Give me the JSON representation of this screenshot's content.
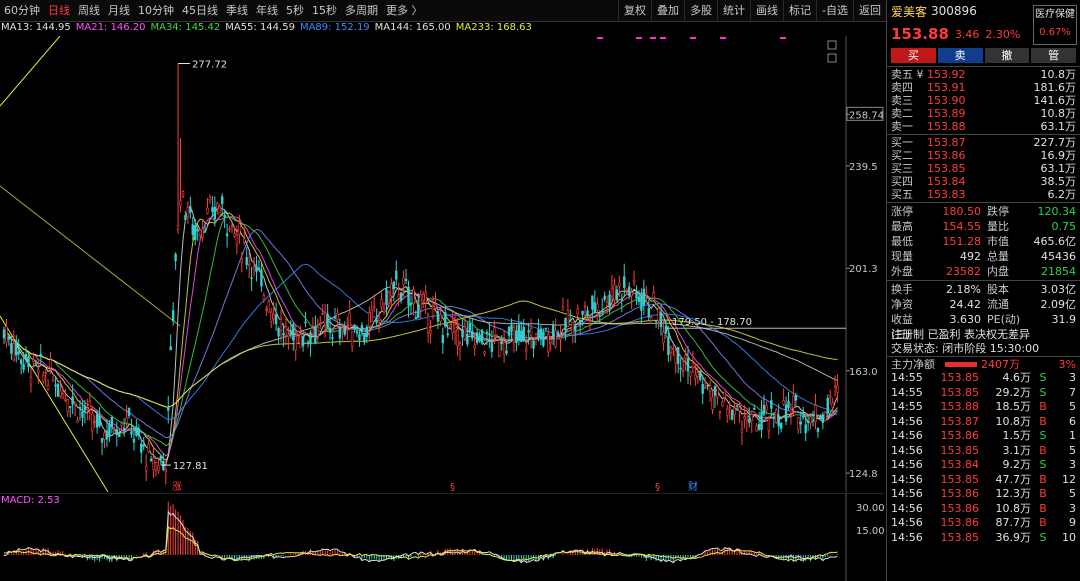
{
  "toolbar": {
    "periods": [
      "60分钟",
      "日线",
      "周线",
      "月线",
      "10分钟",
      "45日线",
      "季线",
      "年线",
      "5秒",
      "15秒",
      "多周期",
      "更多 〉"
    ],
    "active_period": "日线",
    "tools": [
      "复权",
      "叠加",
      "多股",
      "统计",
      "画线",
      "标记",
      "-自选",
      "返回"
    ]
  },
  "ma_line": [
    {
      "text": "MA13: 144.95",
      "color": "#e0e0e0"
    },
    {
      "text": "MA21: 146.20",
      "color": "#ff55ff"
    },
    {
      "text": "MA34: 145.42",
      "color": "#3cdc3c"
    },
    {
      "text": "MA55: 144.59",
      "color": "#e0e0e0"
    },
    {
      "text": "MA89: 152.19",
      "color": "#3c8cff"
    },
    {
      "text": "MA144: 165.00",
      "color": "#e0e0e0"
    },
    {
      "text": "MA233: 168.63",
      "color": "#e8e83c"
    }
  ],
  "price_axis": {
    "labels": [
      "258.74",
      "239.5",
      "201.3",
      "163.0",
      "124.8"
    ],
    "levels": [
      258.74,
      239.5,
      201.3,
      163.0,
      124.8
    ]
  },
  "annotations": {
    "high": "277.72",
    "low": "127.81",
    "range": "179.50 - 178.70",
    "zhang": "涨",
    "cai": "财"
  },
  "macd": {
    "label": "MACD: 2.53",
    "axis": [
      "30.00",
      "15.00"
    ]
  },
  "chart_data": {
    "type": "candlestick",
    "ylim": [
      120,
      285
    ],
    "reference_line": 178.9,
    "closes_keypoints": [
      {
        "x": 0,
        "y": 178
      },
      {
        "x": 10,
        "y": 165
      },
      {
        "x": 20,
        "y": 160
      },
      {
        "x": 30,
        "y": 150
      },
      {
        "x": 40,
        "y": 140
      },
      {
        "x": 50,
        "y": 145
      },
      {
        "x": 60,
        "y": 128
      },
      {
        "x": 66,
        "y": 130
      },
      {
        "x": 70,
        "y": 205
      },
      {
        "x": 72,
        "y": 230
      },
      {
        "x": 78,
        "y": 215
      },
      {
        "x": 88,
        "y": 225
      },
      {
        "x": 100,
        "y": 205
      },
      {
        "x": 115,
        "y": 175
      },
      {
        "x": 130,
        "y": 180
      },
      {
        "x": 148,
        "y": 178
      },
      {
        "x": 160,
        "y": 195
      },
      {
        "x": 172,
        "y": 185
      },
      {
        "x": 185,
        "y": 176
      },
      {
        "x": 200,
        "y": 174
      },
      {
        "x": 220,
        "y": 176
      },
      {
        "x": 240,
        "y": 186
      },
      {
        "x": 252,
        "y": 195
      },
      {
        "x": 262,
        "y": 190
      },
      {
        "x": 275,
        "y": 170
      },
      {
        "x": 290,
        "y": 152
      },
      {
        "x": 305,
        "y": 143
      },
      {
        "x": 320,
        "y": 148
      },
      {
        "x": 332,
        "y": 145
      },
      {
        "x": 340,
        "y": 154
      }
    ]
  },
  "right": {
    "name": "爱美客",
    "code": "300896",
    "tag": "医疗保健",
    "tag_pct": "0.67%",
    "price": "153.88",
    "change": "3.46",
    "change_pct": "2.30%",
    "btn_buy": "买",
    "btn_sell": "卖",
    "btn_cancel": "撤",
    "btn_modify": "管",
    "asks": [
      {
        "label": "卖五 ¥",
        "price": "153.92",
        "vol": "10.8万"
      },
      {
        "label": "卖四",
        "price": "153.91",
        "vol": "181.6万"
      },
      {
        "label": "卖三",
        "price": "153.90",
        "vol": "141.6万"
      },
      {
        "label": "卖二",
        "price": "153.89",
        "vol": "10.8万"
      },
      {
        "label": "卖一",
        "price": "153.88",
        "vol": "63.1万"
      }
    ],
    "bids": [
      {
        "label": "买一",
        "price": "153.87",
        "vol": "227.7万"
      },
      {
        "label": "买二",
        "price": "153.86",
        "vol": "16.9万"
      },
      {
        "label": "买三",
        "price": "153.85",
        "vol": "63.1万"
      },
      {
        "label": "买四",
        "price": "153.84",
        "vol": "38.5万"
      },
      {
        "label": "买五",
        "price": "153.83",
        "vol": "6.2万"
      }
    ],
    "stats": [
      {
        "k": "涨停",
        "v": "180.50",
        "vc": "red",
        "k2": "跌停",
        "v2": "120.34",
        "v2c": "green"
      },
      {
        "k": "最高",
        "v": "154.55",
        "vc": "red",
        "k2": "量比",
        "v2": "0.75",
        "v2c": "green"
      },
      {
        "k": "最低",
        "v": "151.28",
        "vc": "red",
        "k2": "市值",
        "v2": "465.6亿",
        "v2c": "white"
      },
      {
        "k": "现量",
        "v": "492",
        "vc": "white",
        "k2": "总量",
        "v2": "45436",
        "v2c": "white"
      },
      {
        "k": "外盘",
        "v": "23582",
        "vc": "red",
        "k2": "内盘",
        "v2": "21854",
        "v2c": "green"
      }
    ],
    "stats2": [
      {
        "k": "换手",
        "v": "2.18%",
        "vc": "white",
        "k2": "股本",
        "v2": "3.03亿",
        "v2c": "white"
      },
      {
        "k": "净资",
        "v": "24.42",
        "vc": "white",
        "k2": "流通",
        "v2": "2.09亿",
        "v2c": "white"
      },
      {
        "k": "收益(三)",
        "v": "3.630",
        "vc": "white",
        "k2": "PE(动)",
        "v2": "31.9",
        "v2c": "white"
      }
    ],
    "reg_line": "注册制 已盈利 表决权无差异",
    "status_line": "交易状态: 闭市阶段 15:30:00",
    "flow_label": "主力净额",
    "flow_value": "2407万",
    "flow_pct": "3%",
    "ticks": [
      {
        "t": "14:55",
        "p": "153.85",
        "q": "4.6万",
        "s": "S",
        "sc": "green",
        "n": "3"
      },
      {
        "t": "14:55",
        "p": "153.85",
        "q": "29.2万",
        "s": "S",
        "sc": "green",
        "n": "7"
      },
      {
        "t": "14:55",
        "p": "153.88",
        "q": "18.5万",
        "s": "B",
        "sc": "red",
        "n": "5"
      },
      {
        "t": "14:56",
        "p": "153.87",
        "q": "10.8万",
        "s": "B",
        "sc": "red",
        "n": "6"
      },
      {
        "t": "14:56",
        "p": "153.86",
        "q": "1.5万",
        "s": "S",
        "sc": "green",
        "n": "1"
      },
      {
        "t": "14:56",
        "p": "153.85",
        "q": "3.1万",
        "s": "B",
        "sc": "red",
        "n": "5"
      },
      {
        "t": "14:56",
        "p": "153.84",
        "q": "9.2万",
        "s": "S",
        "sc": "green",
        "n": "3"
      },
      {
        "t": "14:56",
        "p": "153.85",
        "q": "47.7万",
        "s": "B",
        "sc": "red",
        "n": "12"
      },
      {
        "t": "14:56",
        "p": "153.86",
        "q": "12.3万",
        "s": "B",
        "sc": "red",
        "n": "5"
      },
      {
        "t": "14:56",
        "p": "153.86",
        "q": "10.8万",
        "s": "B",
        "sc": "red",
        "n": "3"
      },
      {
        "t": "14:56",
        "p": "153.86",
        "q": "87.7万",
        "s": "B",
        "sc": "red",
        "n": "9"
      },
      {
        "t": "14:56",
        "p": "153.85",
        "q": "36.9万",
        "s": "S",
        "sc": "green",
        "n": "10"
      }
    ]
  }
}
